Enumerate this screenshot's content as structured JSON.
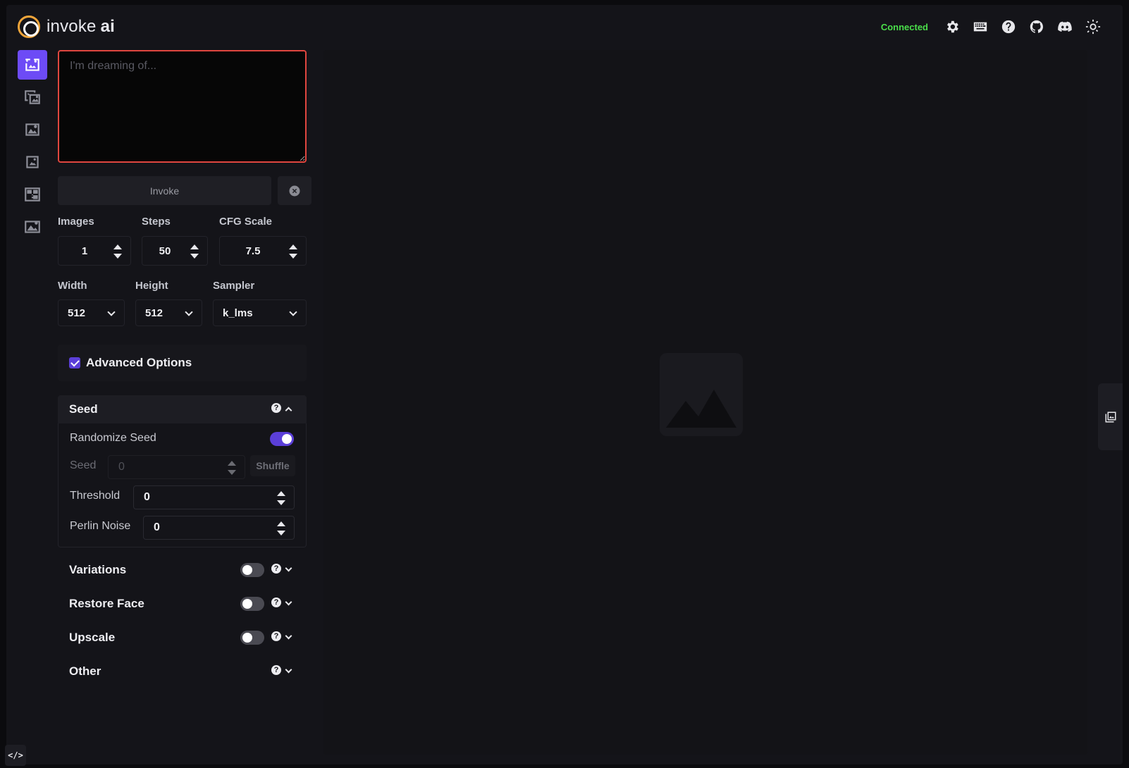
{
  "app": {
    "logo_text": "invoke",
    "logo_text_bold": "ai",
    "status": "Connected",
    "accent_color": "#6d4bf6",
    "status_color": "#4ade4a"
  },
  "header_icons": [
    "settings-icon",
    "keyboard-icon",
    "help-icon",
    "github-icon",
    "discord-icon",
    "theme-icon"
  ],
  "tabs": [
    {
      "name": "text-to-image",
      "active": true
    },
    {
      "name": "image-to-image",
      "active": false
    },
    {
      "name": "inpainting",
      "active": false
    },
    {
      "name": "outpainting",
      "active": false
    },
    {
      "name": "nodes",
      "active": false
    },
    {
      "name": "post-processing",
      "active": false
    }
  ],
  "prompt": {
    "placeholder": "I'm dreaming of...",
    "value": ""
  },
  "actions": {
    "invoke_label": "Invoke"
  },
  "params": {
    "images_label": "Images",
    "images_value": "1",
    "steps_label": "Steps",
    "steps_value": "50",
    "cfg_label": "CFG Scale",
    "cfg_value": "7.5",
    "width_label": "Width",
    "width_value": "512",
    "height_label": "Height",
    "height_value": "512",
    "sampler_label": "Sampler",
    "sampler_value": "k_lms"
  },
  "advanced": {
    "label": "Advanced Options",
    "checked": true
  },
  "seed_section": {
    "title": "Seed",
    "randomize_label": "Randomize Seed",
    "seed_label": "Seed",
    "seed_value": "0",
    "shuffle_label": "Shuffle",
    "threshold_label": "Threshold",
    "threshold_value": "0",
    "perlin_label": "Perlin Noise",
    "perlin_value": "0"
  },
  "sections": {
    "variations": "Variations",
    "restore_face": "Restore Face",
    "upscale": "Upscale",
    "other": "Other"
  },
  "help_glyph": "?",
  "console_glyph": "</>"
}
